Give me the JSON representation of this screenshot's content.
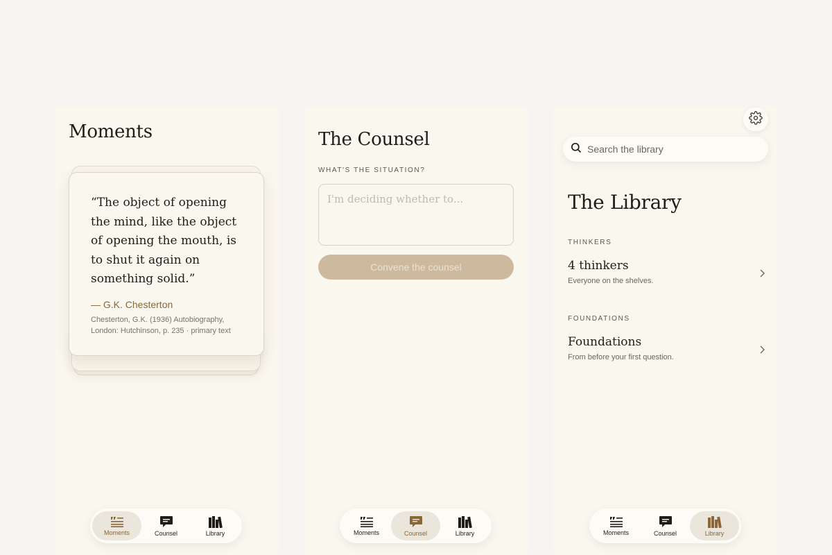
{
  "colors": {
    "background": "#f6f5f2",
    "screen": "#faf7ef",
    "accent": "#8a6638",
    "button_disabled": "#cdb99d",
    "text": "#1f1d1a"
  },
  "moments": {
    "title": "Moments",
    "quote": {
      "text": "“The object of opening the mind, like the object of opening the mouth, is to shut it again on something solid.”",
      "author": "— G.K. Chesterton",
      "source": "Chesterton, G.K. (1936) Autobiography, London: Hutchinson, p. 235 · primary text"
    }
  },
  "counsel": {
    "title": "The Counsel",
    "situation_label": "WHAT'S THE SITUATION?",
    "situation_placeholder": "I'm deciding whether to...",
    "situation_value": "",
    "convene_label": "Convene the counsel"
  },
  "library": {
    "search_placeholder": "Search the library",
    "title": "The Library",
    "thinkers_label": "THINKERS",
    "thinkers_row": {
      "title": "4 thinkers",
      "subtitle": "Everyone on the shelves."
    },
    "foundations_label": "FOUNDATIONS",
    "foundations_row": {
      "title": "Foundations",
      "subtitle": "From before your first question."
    }
  },
  "tabs": {
    "moments": "Moments",
    "counsel": "Counsel",
    "library": "Library"
  },
  "icons": {
    "moments_tab": "quote-lines-icon",
    "counsel_tab": "speech-bubble-icon",
    "library_tab": "books-icon",
    "settings": "gear-icon",
    "search": "search-icon",
    "row_arrow": "chevron-right-icon"
  }
}
